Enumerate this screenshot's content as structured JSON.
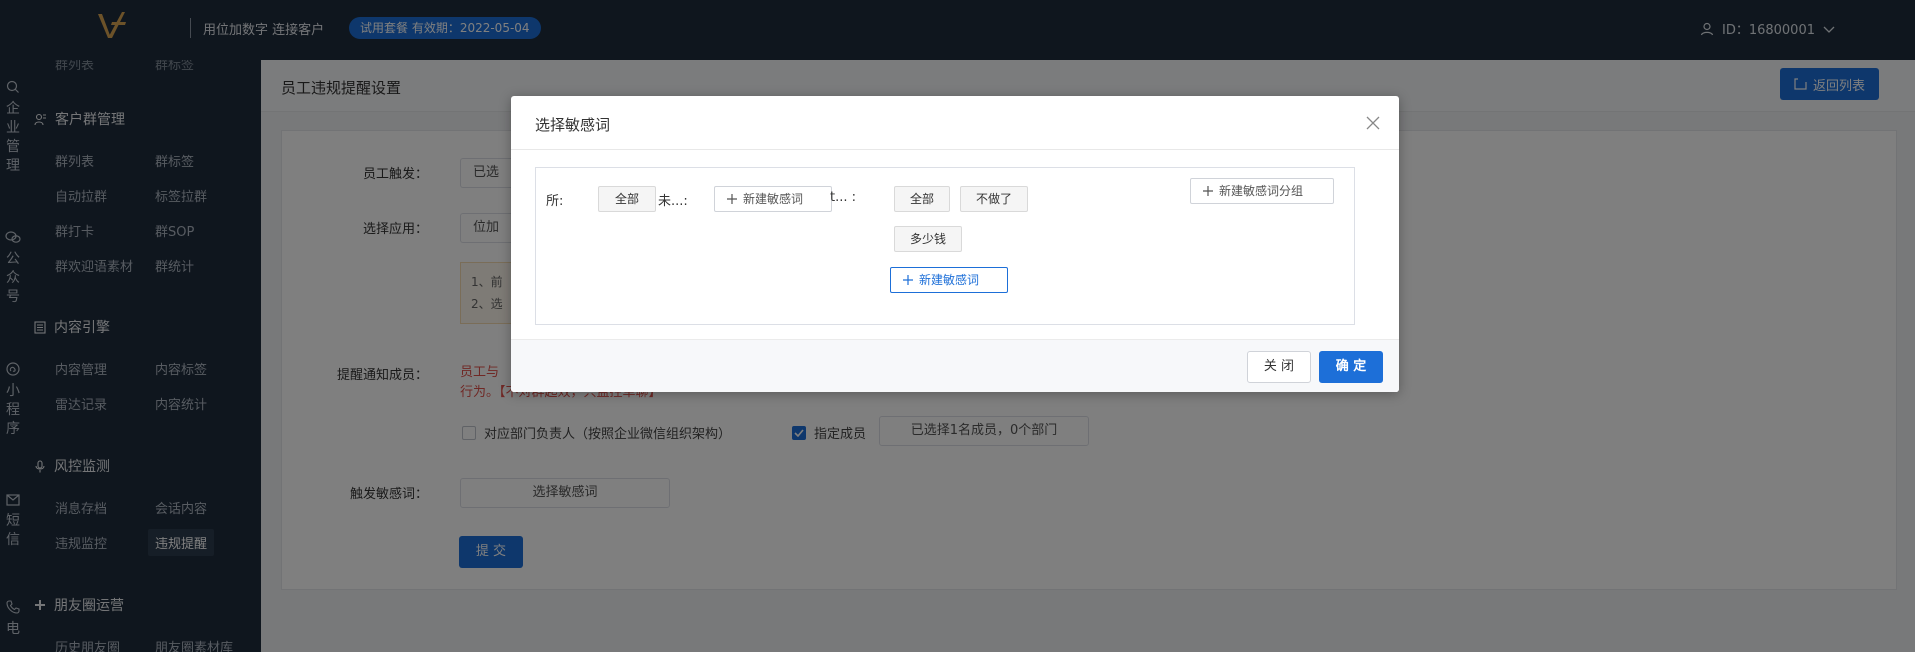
{
  "topbar": {
    "brand": "用位加数字 连接客户",
    "trial_badge": "试用套餐 有效期：2022-05-04",
    "user_id": "ID：16800001"
  },
  "rail": [
    {
      "name": "企业管理",
      "chars": [
        "企",
        "业",
        "管",
        "理"
      ],
      "icon": "building-icon"
    },
    {
      "name": "公众号",
      "chars": [
        "公",
        "众",
        "号"
      ],
      "icon": "wechat-icon"
    },
    {
      "name": "小程序",
      "chars": [
        "小",
        "程",
        "序"
      ],
      "icon": "miniprogram-icon"
    },
    {
      "name": "短信",
      "chars": [
        "短",
        "信"
      ],
      "icon": "mail-icon"
    },
    {
      "name": "电话",
      "chars": [
        "电"
      ],
      "icon": "phone-icon"
    }
  ],
  "sidebar": {
    "partial_top": [
      "群列表",
      "群标签"
    ],
    "groups": [
      {
        "title": "客户群管理",
        "icon": "group-icon",
        "items": [
          "群列表",
          "群标签",
          "自动拉群",
          "标签拉群",
          "群打卡",
          "群SOP",
          "群欢迎语素材",
          "群统计"
        ]
      },
      {
        "title": "内容引擎",
        "icon": "document-icon",
        "items": [
          "内容管理",
          "内容标签",
          "雷达记录",
          "内容统计"
        ]
      },
      {
        "title": "风控监测",
        "icon": "mic-icon",
        "items": [
          "消息存档",
          "会话内容",
          "违规监控",
          "违规提醒"
        ]
      },
      {
        "title": "朋友圈运营",
        "icon": "plus-icon",
        "items": [
          "历史朋友圈",
          "朋友圈素材库"
        ]
      }
    ],
    "active_item": "违规提醒"
  },
  "page": {
    "title": "员工违规提醒设置",
    "back_label": "返回列表",
    "form": {
      "trigger_label": "员工触发：",
      "trigger_value": "已选",
      "app_label": "选择应用：",
      "app_value": "位加",
      "tips": [
        "1、前",
        "2、选"
      ],
      "notify_label": "提醒通知成员：",
      "notify_red_1": "员工与",
      "notify_red_2": "行为。【不对群起效，只监控单聊】",
      "dept_head_label": "对应部门负责人（按照企业微信组织架构）",
      "designated_label": "指定成员",
      "selected_members": "已选择1名成员，0个部门",
      "sensitive_label": "触发敏感词：",
      "sensitive_button": "选择敏感词",
      "submit": "提 交"
    }
  },
  "dialog": {
    "title": "选择敏感词",
    "row_label_1": "所:",
    "chip_all_1": "全部",
    "row_label_2": "未...:",
    "new_word_1": "新建敏感词",
    "row_label_3": "t...  :",
    "chip_all_2": "全部",
    "chip_word_1": "不做了",
    "chip_word_2": "多少钱",
    "new_word_2": "新建敏感词",
    "new_group": "新建敏感词分组",
    "close": "关 闭",
    "confirm": "确 定"
  }
}
